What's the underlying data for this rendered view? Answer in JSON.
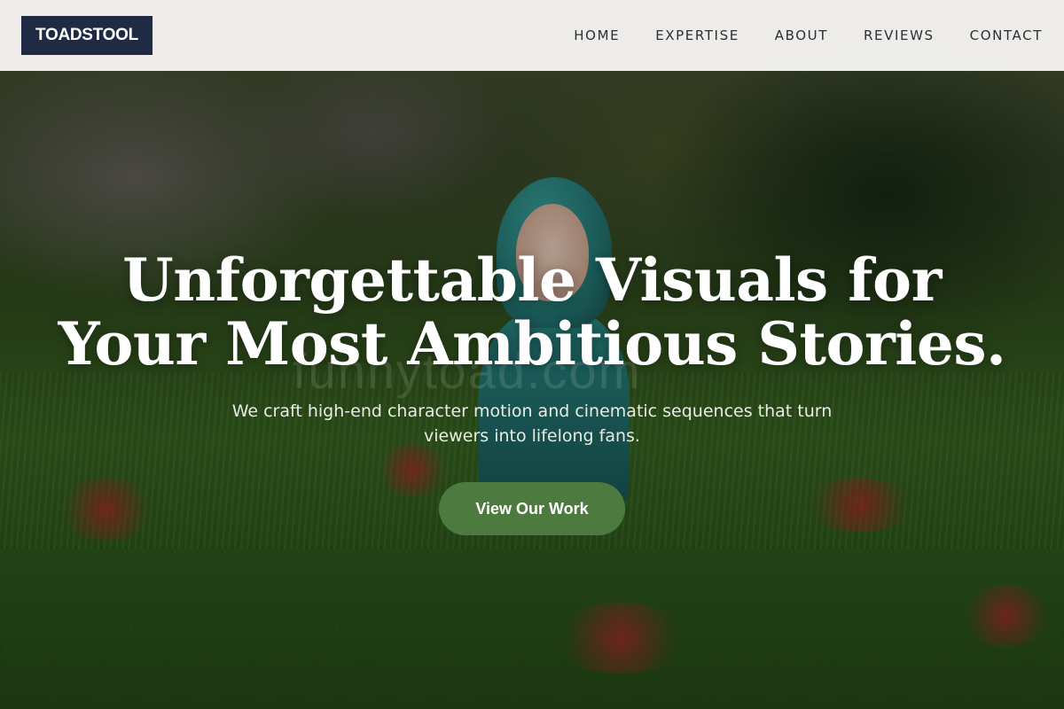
{
  "brand": {
    "logo_text": "TOADSTOOL"
  },
  "nav": {
    "items": [
      {
        "label": "HOME"
      },
      {
        "label": "EXPERTISE"
      },
      {
        "label": "ABOUT"
      },
      {
        "label": "REVIEWS"
      },
      {
        "label": "CONTACT"
      }
    ]
  },
  "hero": {
    "headline_line1": "Unforgettable Visuals for",
    "headline_line2": "Your Most Ambitious Stories.",
    "subtext": "We craft high-end character motion and cinematic sequences that turn viewers into lifelong fans.",
    "cta_label": "View Our Work",
    "watermark": "funnytoad.com"
  },
  "colors": {
    "logo_bg": "#1f2a44",
    "header_bg": "#f5f4f1",
    "cta_bg": "#4d7a3e",
    "text_on_hero": "#ffffff"
  }
}
